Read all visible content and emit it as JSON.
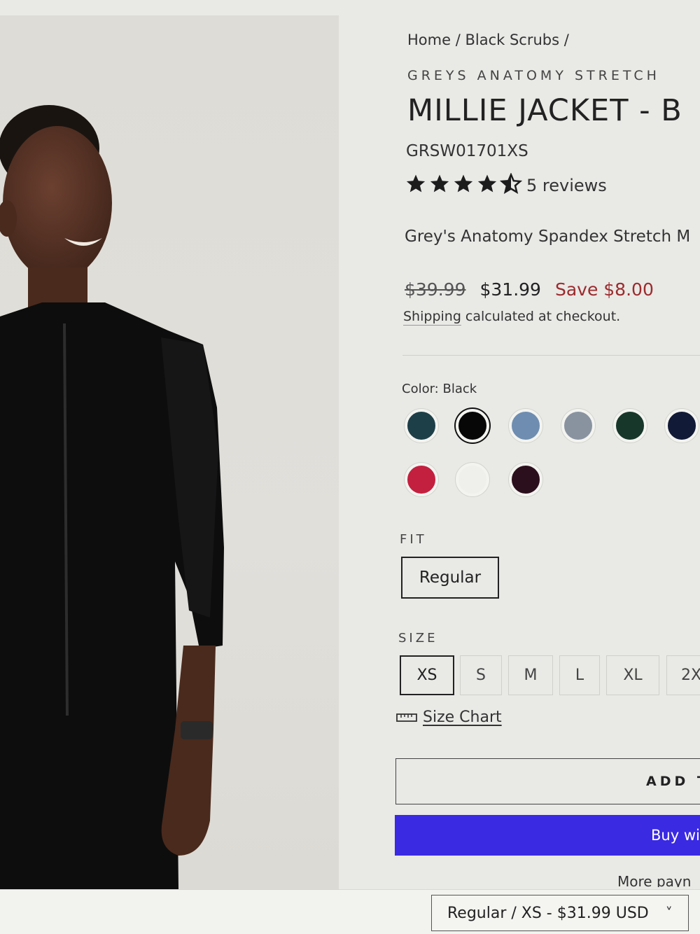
{
  "breadcrumb": {
    "home": "Home",
    "sep1": " / ",
    "category": "Black Scrubs",
    "sep2": " /"
  },
  "product": {
    "vendor": "GREYS ANATOMY STRETCH",
    "title": "MILLIE JACKET - B",
    "sku": "GRSW01701XS",
    "rating": 4.5,
    "reviews_label": "5 reviews",
    "description": "Grey's Anatomy Spandex Stretch M"
  },
  "price": {
    "compare_at": "$39.99",
    "current": "$31.99",
    "savings": "Save $8.00",
    "shipping_link": "Shipping",
    "shipping_rest": " calculated at checkout."
  },
  "color": {
    "label": "Color: Black",
    "selected": "Black",
    "swatches": [
      "#1d3f48",
      "#070707",
      "#6e8db0",
      "#8993a0",
      "#17372a",
      "#111a36",
      "#c3203f",
      "#efefec",
      "#2c0f1c"
    ]
  },
  "fit": {
    "label": "FIT",
    "options": [
      "Regular"
    ],
    "selected": "Regular"
  },
  "size": {
    "label": "SIZE",
    "options": [
      "XS",
      "S",
      "M",
      "L",
      "XL",
      "2X"
    ],
    "selected": "XS",
    "chart_label": "Size Chart"
  },
  "actions": {
    "add_to_cart": "ADD T",
    "buy_now": "Buy wi",
    "more_payment": "More payn"
  },
  "sticky": {
    "variant": "Regular / XS - $31.99 USD",
    "chevron": "˅"
  }
}
